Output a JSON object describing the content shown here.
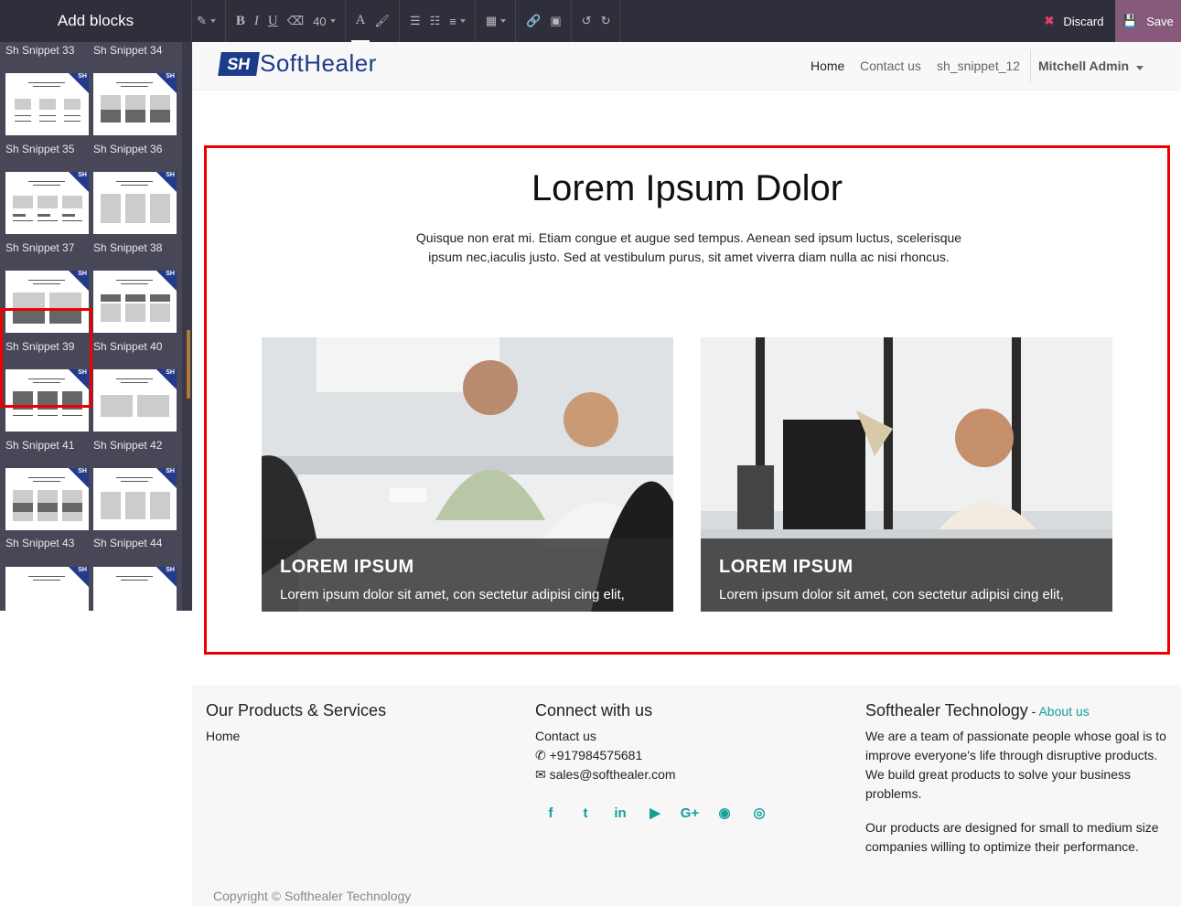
{
  "editor": {
    "sidebar_title": "Add blocks",
    "font_size": "40",
    "discard_label": "Discard",
    "save_label": "Save"
  },
  "snippets": [
    {
      "label": "Sh Snippet 33"
    },
    {
      "label": "Sh Snippet 34"
    },
    {
      "label": "Sh Snippet 35"
    },
    {
      "label": "Sh Snippet 36"
    },
    {
      "label": "Sh Snippet 37"
    },
    {
      "label": "Sh Snippet 38"
    },
    {
      "label": "Sh Snippet 39"
    },
    {
      "label": "Sh Snippet 40"
    },
    {
      "label": "Sh Snippet 41"
    },
    {
      "label": "Sh Snippet 42"
    },
    {
      "label": "Sh Snippet 43"
    },
    {
      "label": "Sh Snippet 44"
    }
  ],
  "selected_snippet": "Sh Snippet 39",
  "site": {
    "logo_mark": "SH",
    "logo_text": "SoftHealer",
    "nav": {
      "home": "Home",
      "contact": "Contact us",
      "snippet": "sh_snippet_12",
      "user": "Mitchell Admin"
    }
  },
  "section": {
    "title": "Lorem Ipsum Dolor",
    "description": "Quisque non erat mi. Etiam congue et augue sed tempus. Aenean sed ipsum luctus, scelerisque ipsum nec,iaculis justo. Sed at vestibulum purus, sit amet viverra diam nulla ac nisi rhoncus.",
    "cards": [
      {
        "title": "LOREM IPSUM",
        "text": "Lorem ipsum dolor sit amet, con sectetur adipisi cing elit,"
      },
      {
        "title": "LOREM IPSUM",
        "text": "Lorem ipsum dolor sit amet, con sectetur adipisi cing elit,"
      }
    ]
  },
  "footer": {
    "col1": {
      "heading": "Our Products & Services",
      "link": "Home"
    },
    "col2": {
      "heading": "Connect with us",
      "link": "Contact us",
      "phone": "+917984575681",
      "email": "sales@softhealer.com"
    },
    "col3": {
      "heading": "Softhealer Technology",
      "sep": " - ",
      "link": "About us",
      "p1": "We are a team of passionate people whose goal is to improve everyone's life through disruptive products. We build great products to solve your business problems.",
      "p2": "Our products are designed for small to medium size companies willing to optimize their performance."
    },
    "social": [
      "facebook-icon",
      "twitter-icon",
      "linkedin-icon",
      "youtube-icon",
      "google-plus-icon",
      "github-icon",
      "instagram-icon"
    ],
    "copyright": "Copyright © Softhealer Technology"
  },
  "colors": {
    "accent": "#12a09a",
    "save": "#875a7b",
    "selection": "#e00000",
    "topbar": "#2f2f3b"
  }
}
